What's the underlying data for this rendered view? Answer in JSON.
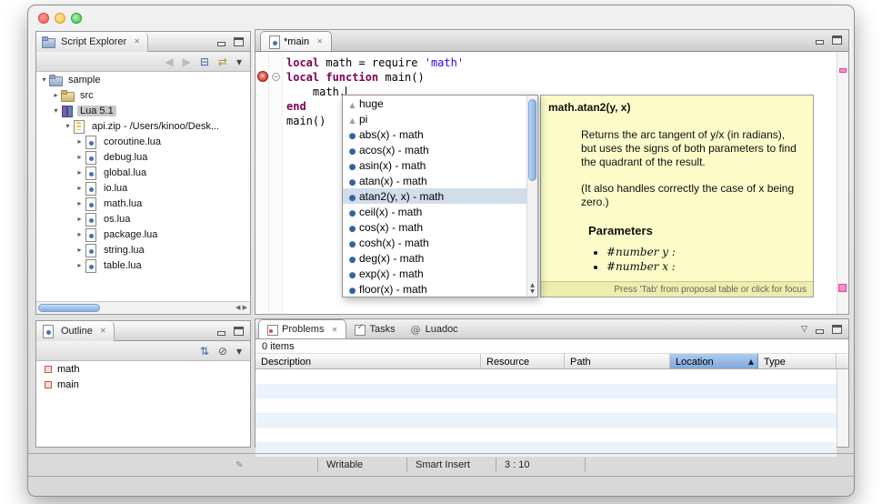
{
  "window": {
    "controls": [
      "close",
      "minimize",
      "zoom"
    ]
  },
  "script_explorer": {
    "title": "Script Explorer",
    "toolbar": [
      "back",
      "forward",
      "collapse-all",
      "link-with-editor",
      "view-menu"
    ],
    "tree": [
      {
        "label": "sample",
        "depth": 0,
        "arrow": "expanded",
        "icon": "project",
        "selected": false
      },
      {
        "label": "src",
        "depth": 1,
        "arrow": "collapsed",
        "icon": "folder",
        "selected": false
      },
      {
        "label": "Lua 5.1",
        "depth": 1,
        "arrow": "expanded",
        "icon": "library",
        "selected": true
      },
      {
        "label": "api.zip - /Users/kinoo/Desk...",
        "depth": 2,
        "arrow": "expanded",
        "icon": "archive",
        "selected": false
      },
      {
        "label": "coroutine.lua",
        "depth": 3,
        "arrow": "collapsed",
        "icon": "lua",
        "selected": false
      },
      {
        "label": "debug.lua",
        "depth": 3,
        "arrow": "collapsed",
        "icon": "lua",
        "selected": false
      },
      {
        "label": "global.lua",
        "depth": 3,
        "arrow": "collapsed",
        "icon": "lua",
        "selected": false
      },
      {
        "label": "io.lua",
        "depth": 3,
        "arrow": "collapsed",
        "icon": "lua",
        "selected": false
      },
      {
        "label": "math.lua",
        "depth": 3,
        "arrow": "collapsed",
        "icon": "lua",
        "selected": false
      },
      {
        "label": "os.lua",
        "depth": 3,
        "arrow": "collapsed",
        "icon": "lua",
        "selected": false
      },
      {
        "label": "package.lua",
        "depth": 3,
        "arrow": "collapsed",
        "icon": "lua",
        "selected": false
      },
      {
        "label": "string.lua",
        "depth": 3,
        "arrow": "collapsed",
        "icon": "lua",
        "selected": false
      },
      {
        "label": "table.lua",
        "depth": 3,
        "arrow": "collapsed",
        "icon": "lua",
        "selected": false
      }
    ]
  },
  "outline": {
    "title": "Outline",
    "toolbar": [
      "sort",
      "hide",
      "view-menu"
    ],
    "items": [
      {
        "label": "math"
      },
      {
        "label": "main"
      }
    ]
  },
  "editor": {
    "tab_label": "*main",
    "code": [
      {
        "tokens": [
          {
            "text": "local",
            "style": "kw"
          },
          {
            "text": " math = require ",
            "style": "plain"
          },
          {
            "text": "'math'",
            "style": "str"
          }
        ]
      },
      {
        "tokens": [
          {
            "text": "local",
            "style": "kw"
          },
          {
            "text": " ",
            "style": "plain"
          },
          {
            "text": "function",
            "style": "kw"
          },
          {
            "text": " main()",
            "style": "plain"
          }
        ],
        "error": true,
        "fold": true
      },
      {
        "tokens": [
          {
            "text": "    math.",
            "style": "plain"
          }
        ]
      },
      {
        "tokens": [
          {
            "text": "end",
            "style": "kw"
          }
        ]
      },
      {
        "tokens": [
          {
            "text": "main()",
            "style": "plain"
          }
        ]
      }
    ]
  },
  "completion": {
    "items": [
      {
        "label": "huge",
        "kind": "field",
        "selected": false
      },
      {
        "label": "pi",
        "kind": "field",
        "selected": false
      },
      {
        "label": "abs(x) - math",
        "kind": "function",
        "selected": false
      },
      {
        "label": "acos(x) - math",
        "kind": "function",
        "selected": false
      },
      {
        "label": "asin(x) - math",
        "kind": "function",
        "selected": false
      },
      {
        "label": "atan(x) - math",
        "kind": "function",
        "selected": false
      },
      {
        "label": "atan2(y, x) - math",
        "kind": "function",
        "selected": true
      },
      {
        "label": "ceil(x) - math",
        "kind": "function",
        "selected": false
      },
      {
        "label": "cos(x) - math",
        "kind": "function",
        "selected": false
      },
      {
        "label": "cosh(x) - math",
        "kind": "function",
        "selected": false
      },
      {
        "label": "deg(x) - math",
        "kind": "function",
        "selected": false
      },
      {
        "label": "exp(x) - math",
        "kind": "function",
        "selected": false
      },
      {
        "label": "floor(x) - math",
        "kind": "function",
        "selected": false
      }
    ]
  },
  "doc": {
    "title": "math.atan2(y, x)",
    "paragraphs": [
      "Returns the arc tangent of y/x (in radians), but uses the signs of both parameters to find the quadrant of the result.",
      "(It also handles correctly the case of x being zero.)"
    ],
    "params_heading": "Parameters",
    "params": [
      "#number y :",
      "#number x :"
    ],
    "footer_hint": "Press 'Tab' from proposal table or click for focus"
  },
  "problems": {
    "tabs": [
      {
        "label": "Problems",
        "selected": true
      },
      {
        "label": "Tasks",
        "selected": false
      },
      {
        "label": "Luadoc",
        "selected": false
      }
    ],
    "summary": "0 items",
    "columns": [
      {
        "label": "Description",
        "sorted": false
      },
      {
        "label": "Resource",
        "sorted": false
      },
      {
        "label": "Path",
        "sorted": false
      },
      {
        "label": "Location",
        "sorted": true
      },
      {
        "label": "Type",
        "sorted": false
      }
    ],
    "empty_rows": 6
  },
  "status_bar": {
    "writable": "Writable",
    "insert_mode": "Smart Insert",
    "caret_position": "3 : 10"
  }
}
